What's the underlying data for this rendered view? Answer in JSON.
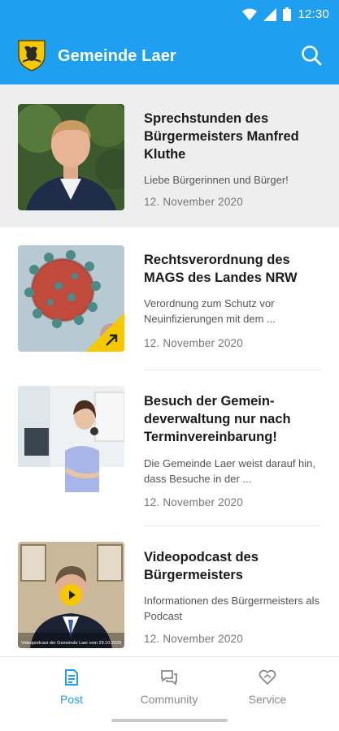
{
  "status_bar": {
    "time": "12:30",
    "icons": [
      "wifi-icon",
      "signal-icon",
      "battery-icon"
    ]
  },
  "app_bar": {
    "title": "Gemeinde Laer",
    "logo": "coat-of-arms-logo",
    "search_icon": "search-icon"
  },
  "colors": {
    "primary": "#1e9fef",
    "accent_yellow": "#f5c800",
    "highlight_bg": "#eeeeee"
  },
  "posts": [
    {
      "title": "Sprechstunden des Bürgermeisters Manfred Kluthe",
      "excerpt": "Liebe Bürgerinnen und Bürger!",
      "date": "12. November 2020",
      "highlighted": true
    },
    {
      "title": "Rechtsverordnung des MAGS des Landes NRW",
      "excerpt": "Verordnung zum Schutz vor Neuinfizierungen mit dem ...",
      "date": "12. November 2020",
      "badge": "external-link-icon"
    },
    {
      "title": "Besuch der Gemein-deverwaltung nur nach Terminvereinbarung!",
      "excerpt": "Die Gemeinde Laer weist darauf hin, dass Besuche in der ...",
      "date": "12. November 2020"
    },
    {
      "title": "Videopodcast des Bürgermeisters",
      "excerpt": "Informationen des Bürgermeisters als Podcast",
      "date": "12. November 2020",
      "badge": "play-icon",
      "caption": "Videopodcast der Gemeinde Laer vom 29.10.2020"
    }
  ],
  "bottom_nav": [
    {
      "label": "Post",
      "icon": "post-icon",
      "active": true
    },
    {
      "label": "Community",
      "icon": "community-icon",
      "active": false
    },
    {
      "label": "Service",
      "icon": "service-icon",
      "active": false
    }
  ]
}
